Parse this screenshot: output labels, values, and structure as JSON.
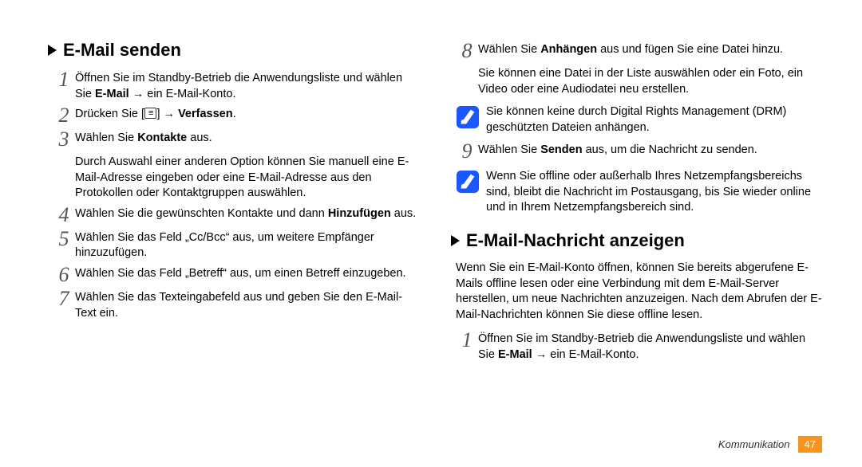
{
  "left": {
    "heading": "E-Mail senden",
    "steps": {
      "s1a": "Öffnen Sie im Standby-Betrieb die Anwendungsliste und wählen Sie ",
      "s1b": "E-Mail",
      "s1c": " → ein E-Mail-Konto.",
      "s2a": "Drücken Sie [",
      "s2b": "] → ",
      "s2c": "Verfassen",
      "s2d": ".",
      "s3a": "Wählen Sie ",
      "s3b": "Kontakte",
      "s3c": " aus.",
      "s3sub": "Durch Auswahl einer anderen Option können Sie manuell eine E-Mail-Adresse eingeben oder eine E-Mail-Adresse aus den Protokollen oder Kontaktgruppen auswählen.",
      "s4a": "Wählen Sie die gewünschten Kontakte und dann ",
      "s4b": "Hinzufügen",
      "s4c": " aus.",
      "s5": "Wählen Sie das Feld „Cc/Bcc“ aus, um weitere Empfänger hinzuzufügen.",
      "s6": "Wählen Sie das Feld „Betreff“ aus, um einen Betreff einzugeben.",
      "s7": "Wählen Sie das Texteingabefeld aus und geben Sie den E-Mail-Text ein."
    }
  },
  "right": {
    "steps": {
      "s8a": "Wählen Sie ",
      "s8b": "Anhängen",
      "s8c": " aus und fügen Sie eine Datei hinzu.",
      "s8sub": "Sie können eine Datei in der Liste auswählen oder ein Foto, ein Video oder eine Audiodatei neu erstellen.",
      "note1": "Sie können keine durch Digital Rights Management (DRM) geschützten Dateien anhängen.",
      "s9a": "Wählen Sie ",
      "s9b": "Senden",
      "s9c": " aus, um die Nachricht zu senden.",
      "note2": "Wenn Sie offline oder außerhalb Ihres Netzempfangsbereichs sind, bleibt die Nachricht im Postausgang, bis Sie wieder online und in Ihrem Netzempfangsbereich sind."
    },
    "heading2": "E-Mail-Nachricht anzeigen",
    "para": "Wenn Sie ein E-Mail-Konto öffnen, können Sie bereits abgerufene E-Mails offline lesen oder eine Verbindung mit dem E-Mail-Server herstellen, um neue Nachrichten anzuzeigen. Nach dem Abrufen der E-Mail-Nachrichten können Sie diese offline lesen.",
    "v1a": "Öffnen Sie im Standby-Betrieb die Anwendungsliste und wählen Sie ",
    "v1b": "E-Mail",
    "v1c": " → ein E-Mail-Konto."
  },
  "nums": {
    "n1": "1",
    "n2": "2",
    "n3": "3",
    "n4": "4",
    "n5": "5",
    "n6": "6",
    "n7": "7",
    "n8": "8",
    "n9": "9"
  },
  "footer": {
    "section": "Kommunikation",
    "page": "47"
  }
}
